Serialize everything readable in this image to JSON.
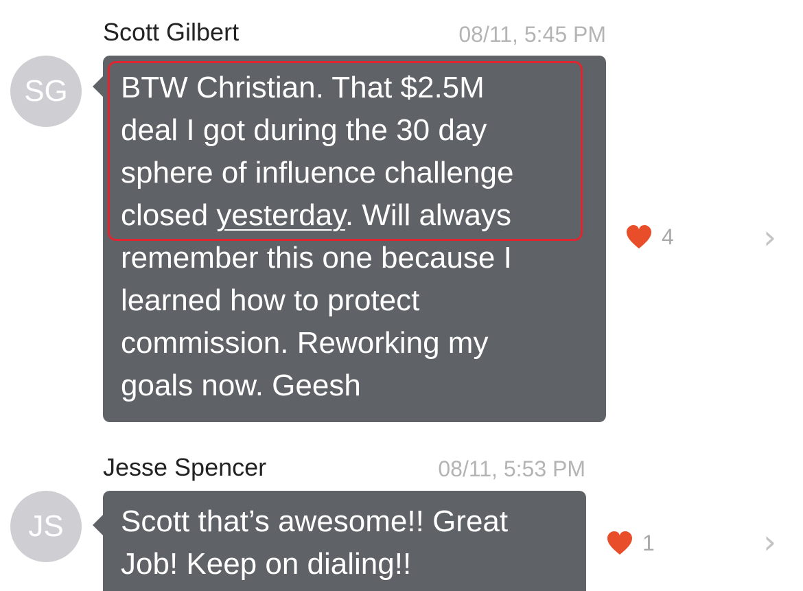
{
  "messages": [
    {
      "sender": "Scott Gilbert",
      "timestamp": "08/11, 5:45 PM",
      "initials": "SG",
      "text_lines": [
        "BTW Christian. That $2.5M",
        "deal I got during the 30 day",
        "sphere of influence challenge"
      ],
      "line4_pre": "closed ",
      "line4_underlined": "yesterday",
      "line4_post": ". Will always",
      "text_rest": "remember this one because I\nlearned how to protect\ncommission. Reworking my\ngoals now. Geesh",
      "likes": "4"
    },
    {
      "sender": "Jesse Spencer",
      "timestamp": "08/11, 5:53 PM",
      "initials": "JS",
      "text": "Scott that’s awesome!! Great\nJob! Keep on dialing!!",
      "likes": "1"
    }
  ],
  "colors": {
    "bubble": "#5f6367",
    "heart": "#e94e2b",
    "highlight": "#e0252f",
    "avatar": "#cfcfd3"
  },
  "icons": {
    "like": "heart-icon",
    "open": "chevron-right-icon"
  }
}
